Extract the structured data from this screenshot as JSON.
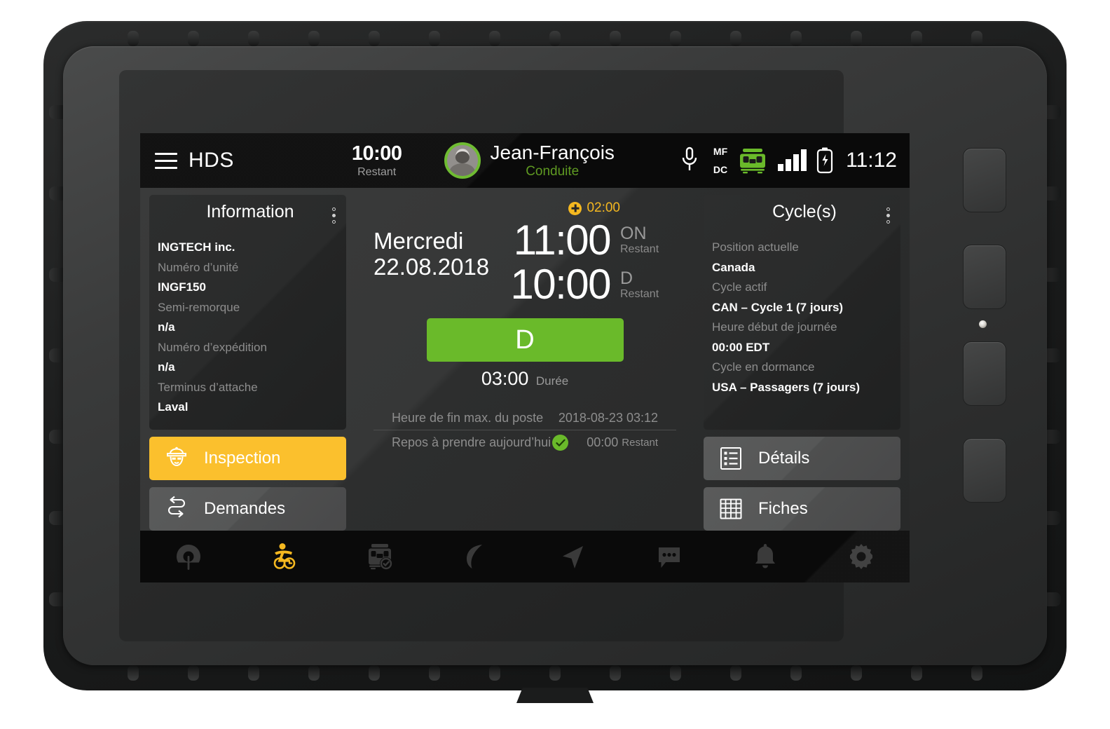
{
  "app": {
    "title": "HDS",
    "menu_icon": "hamburger-icon"
  },
  "header": {
    "remaining_time": "10:00",
    "remaining_label": "Restant",
    "driver_name": "Jean-François",
    "driver_status": "Conduite",
    "mic_icon": "microphone-icon",
    "mf_label": "MF",
    "dc_label": "DC",
    "truck_icon": "truck-icon",
    "signal_icon": "signal-bars-icon",
    "battery_icon": "battery-charging-icon",
    "clock": "11:12",
    "accent_green": "#6aba2a"
  },
  "information_panel": {
    "title": "Information",
    "menu_icon": "kebab-menu-icon",
    "rows": [
      {
        "type": "value",
        "text": "INGTECH inc."
      },
      {
        "type": "label",
        "text": "Numéro d’unité"
      },
      {
        "type": "value",
        "text": "INGF150"
      },
      {
        "type": "label",
        "text": "Semi-remorque"
      },
      {
        "type": "value",
        "text": "n/a"
      },
      {
        "type": "label",
        "text": "Numéro d’expédition"
      },
      {
        "type": "value",
        "text": "n/a"
      },
      {
        "type": "label",
        "text": "Terminus d’attache"
      },
      {
        "type": "value",
        "text": "Laval"
      }
    ],
    "buttons": [
      {
        "label": "Inspection",
        "icon": "police-officer-icon",
        "style": "primary"
      },
      {
        "label": "Demandes",
        "icon": "exchange-arrows-icon",
        "style": "neutral"
      }
    ]
  },
  "center_panel": {
    "weekday": "Mercredi",
    "date": "22.08.2018",
    "extension_badge": "02:00",
    "timers": [
      {
        "value": "11:00",
        "code": "ON",
        "meta": "Restant"
      },
      {
        "value": "10:00",
        "code": "D",
        "meta": "Restant"
      }
    ],
    "duty_status": "D",
    "duty_color": "#6aba2a",
    "duration_value": "03:00",
    "duration_label": "Durée",
    "footer": [
      {
        "label": "Heure de fin max. du poste",
        "value": "2018-08-23 03:12"
      },
      {
        "label": "Repos à prendre aujourd’hui",
        "check_icon": "check-circle-icon",
        "value": "00:00",
        "value_suffix": "Restant"
      }
    ]
  },
  "cycles_panel": {
    "title": "Cycle(s)",
    "menu_icon": "kebab-menu-icon",
    "rows": [
      {
        "type": "label",
        "text": "Position actuelle"
      },
      {
        "type": "value",
        "text": "Canada"
      },
      {
        "type": "label",
        "text": "Cycle actif"
      },
      {
        "type": "value",
        "text": "CAN – Cycle 1 (7 jours)"
      },
      {
        "type": "label",
        "text": "Heure début de journée"
      },
      {
        "type": "value",
        "text": "00:00 EDT"
      },
      {
        "type": "label",
        "text": "Cycle en dormance"
      },
      {
        "type": "value",
        "text": "USA – Passagers (7 jours)"
      }
    ],
    "buttons": [
      {
        "label": "Détails",
        "icon": "list-details-icon",
        "style": "neutral"
      },
      {
        "label": "Fiches",
        "icon": "grid-sheets-icon",
        "style": "neutral"
      }
    ]
  },
  "bottom_nav": {
    "items": [
      {
        "name": "nav-dashboard",
        "icon": "gauge-icon",
        "active": false
      },
      {
        "name": "nav-hours-of-service",
        "icon": "driver-clock-icon",
        "active": true
      },
      {
        "name": "nav-vehicle-inspection",
        "icon": "truck-check-icon",
        "active": false
      },
      {
        "name": "nav-eco",
        "icon": "leaf-icon",
        "active": false
      },
      {
        "name": "nav-navigation",
        "icon": "navigation-arrow-icon",
        "active": false
      },
      {
        "name": "nav-messages",
        "icon": "chat-bubble-icon",
        "active": false
      },
      {
        "name": "nav-alerts",
        "icon": "bell-icon",
        "active": false
      },
      {
        "name": "nav-settings",
        "icon": "gear-icon",
        "active": false
      }
    ],
    "active_color": "#f5b820",
    "inactive_color": "#3a3a3a"
  }
}
